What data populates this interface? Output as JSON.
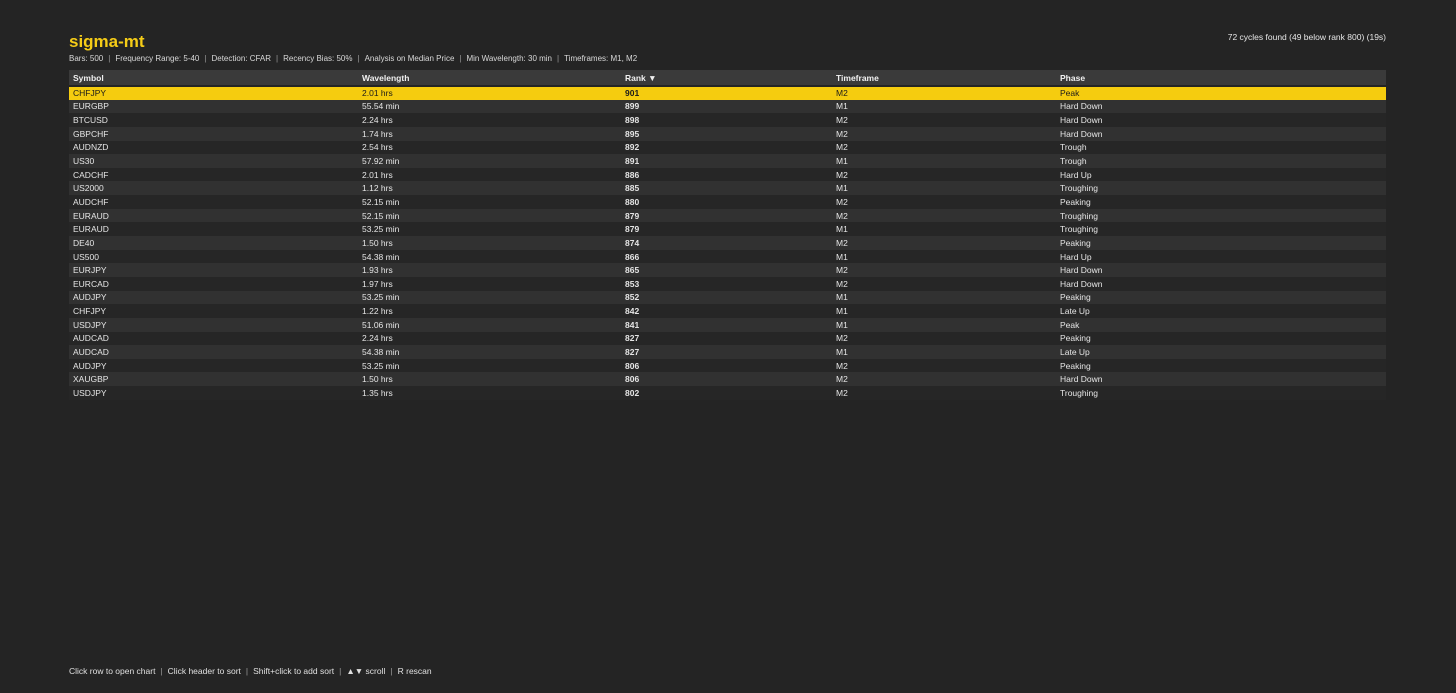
{
  "app": {
    "title": "sigma-mt",
    "summary": "72 cycles found (49 below rank 800) (19s)"
  },
  "settings": [
    "Bars: 500",
    "Frequency Range: 5-40",
    "Detection: CFAR",
    "Recency Bias: 50%",
    "Analysis on Median Price",
    "Min Wavelength: 30 min",
    "Timeframes: M1, M2"
  ],
  "table": {
    "columns": [
      "Symbol",
      "Wavelength",
      "Rank ▼",
      "Timeframe",
      "Phase"
    ],
    "selected_index": 0,
    "rows": [
      [
        "CHFJPY",
        "2.01 hrs",
        "901",
        "M2",
        "Peak"
      ],
      [
        "EURGBP",
        "55.54 min",
        "899",
        "M1",
        "Hard Down"
      ],
      [
        "BTCUSD",
        "2.24 hrs",
        "898",
        "M2",
        "Hard Down"
      ],
      [
        "GBPCHF",
        "1.74 hrs",
        "895",
        "M2",
        "Hard Down"
      ],
      [
        "AUDNZD",
        "2.54 hrs",
        "892",
        "M2",
        "Trough"
      ],
      [
        "US30",
        "57.92 min",
        "891",
        "M1",
        "Trough"
      ],
      [
        "CADCHF",
        "2.01 hrs",
        "886",
        "M2",
        "Hard Up"
      ],
      [
        "US2000",
        "1.12 hrs",
        "885",
        "M1",
        "Troughing"
      ],
      [
        "AUDCHF",
        "52.15 min",
        "880",
        "M2",
        "Peaking"
      ],
      [
        "EURAUD",
        "52.15 min",
        "879",
        "M2",
        "Troughing"
      ],
      [
        "EURAUD",
        "53.25 min",
        "879",
        "M1",
        "Troughing"
      ],
      [
        "DE40",
        "1.50 hrs",
        "874",
        "M2",
        "Peaking"
      ],
      [
        "US500",
        "54.38 min",
        "866",
        "M1",
        "Hard Up"
      ],
      [
        "EURJPY",
        "1.93 hrs",
        "865",
        "M2",
        "Hard Down"
      ],
      [
        "EURCAD",
        "1.97 hrs",
        "853",
        "M2",
        "Hard Down"
      ],
      [
        "AUDJPY",
        "53.25 min",
        "852",
        "M1",
        "Peaking"
      ],
      [
        "CHFJPY",
        "1.22 hrs",
        "842",
        "M1",
        "Late Up"
      ],
      [
        "USDJPY",
        "51.06 min",
        "841",
        "M1",
        "Peak"
      ],
      [
        "AUDCAD",
        "2.24 hrs",
        "827",
        "M2",
        "Peaking"
      ],
      [
        "AUDCAD",
        "54.38 min",
        "827",
        "M1",
        "Late Up"
      ],
      [
        "AUDJPY",
        "53.25 min",
        "806",
        "M2",
        "Peaking"
      ],
      [
        "XAUGBP",
        "1.50 hrs",
        "806",
        "M2",
        "Hard Down"
      ],
      [
        "USDJPY",
        "1.35 hrs",
        "802",
        "M2",
        "Troughing"
      ]
    ]
  },
  "footer": [
    "Click row to open chart",
    "Click header to sort",
    "Shift+click to add sort",
    "▲▼ scroll",
    "R rescan"
  ],
  "colors": {
    "accent": "#f5cc17",
    "background": "#242424",
    "header_bg": "#3a3a3a",
    "row_alt": "#313131"
  }
}
